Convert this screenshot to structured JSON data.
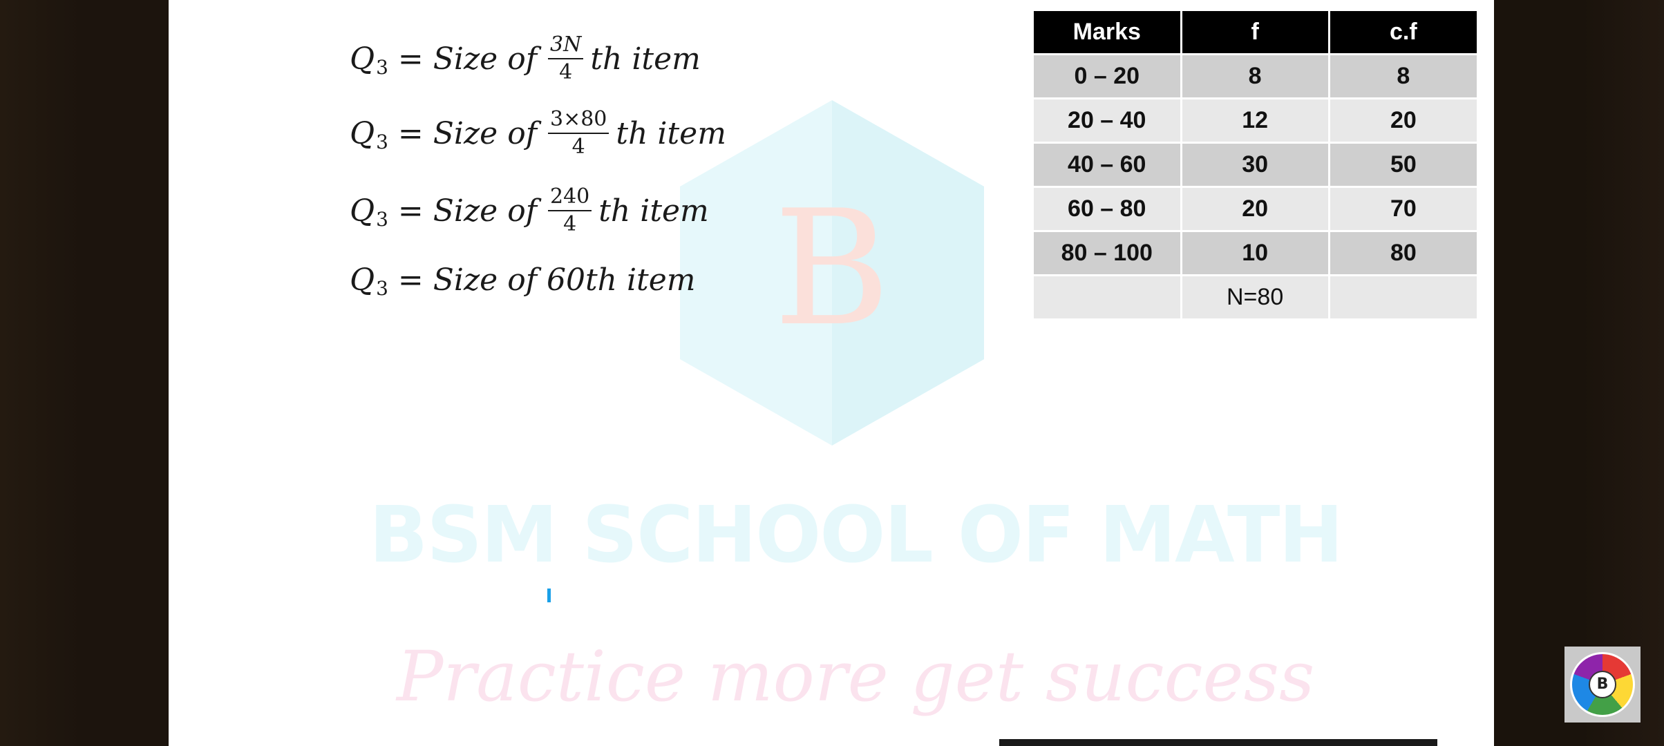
{
  "watermark": {
    "letter": "B",
    "title": "BSM SCHOOL OF MATH",
    "tagline": "Practice more get success"
  },
  "equations": [
    {
      "lhs": "Q",
      "sub": "3",
      "eq": "=",
      "prefix": "Size of",
      "num": "3N",
      "den": "4",
      "suffix": "th item"
    },
    {
      "lhs": "Q",
      "sub": "3",
      "eq": "=",
      "prefix": "Size of",
      "num": "3×80",
      "den": "4",
      "suffix": "th item"
    },
    {
      "lhs": "Q",
      "sub": "3",
      "eq": "=",
      "prefix": "Size of",
      "num": "240",
      "den": "4",
      "suffix": "th item"
    },
    {
      "lhs": "Q",
      "sub": "3",
      "eq": "=",
      "text": "Size of 60th item"
    }
  ],
  "table": {
    "headers": [
      "Marks",
      "f",
      "c.f"
    ],
    "rows": [
      [
        "0 – 20",
        "8",
        "8"
      ],
      [
        "20 – 40",
        "12",
        "20"
      ],
      [
        "40 – 60",
        "30",
        "50"
      ],
      [
        "60 – 80",
        "20",
        "70"
      ],
      [
        "80 – 100",
        "10",
        "80"
      ]
    ],
    "total": [
      "",
      "N=80",
      ""
    ]
  },
  "logo": {
    "letter": "B",
    "icon": "bsm-logo-icon"
  }
}
